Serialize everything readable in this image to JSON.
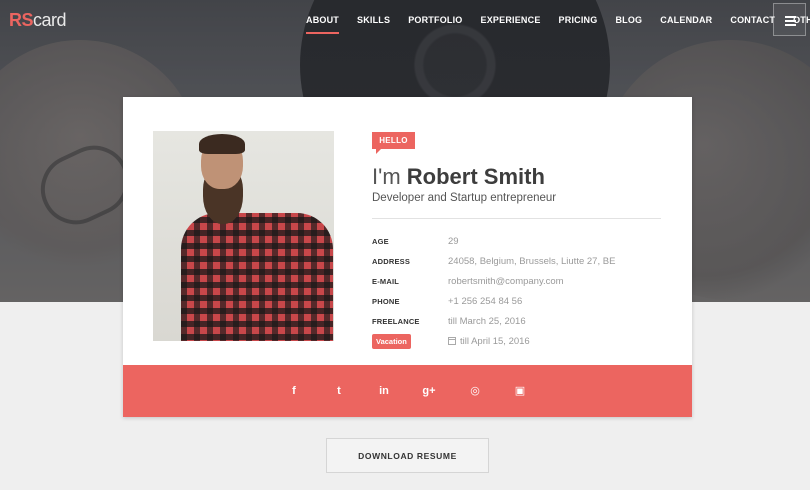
{
  "header": {
    "logo_primary": "RS",
    "logo_secondary": "card",
    "nav": [
      "ABOUT",
      "SKILLS",
      "PORTFOLIO",
      "EXPERIENCE",
      "PRICING",
      "BLOG",
      "CALENDAR",
      "CONTACT",
      "OTHER"
    ],
    "active_nav": "ABOUT"
  },
  "profile": {
    "greeting": "HELLO",
    "name_prefix": "I'm",
    "name": "Robert Smith",
    "title": "Developer and Startup entrepreneur",
    "details": [
      {
        "label": "AGE",
        "value": "29"
      },
      {
        "label": "ADDRESS",
        "value": "24058, Belgium, Brussels, Liutte 27, BE"
      },
      {
        "label": "E-MAIL",
        "value": "robertsmith@company.com"
      },
      {
        "label": "PHONE",
        "value": "+1 256 254 84 56"
      },
      {
        "label": "FREELANCE",
        "value": "till March 25, 2016"
      }
    ],
    "vacation": {
      "label": "Vacation",
      "value": "till April 15, 2016"
    }
  },
  "social": {
    "icons": [
      "facebook-icon",
      "twitter-icon",
      "linkedin-icon",
      "google-plus-icon",
      "dribbble-icon",
      "instagram-icon"
    ],
    "glyphs": [
      "f",
      "t",
      "in",
      "g+",
      "◎",
      "▣"
    ]
  },
  "download_button": "DOWNLOAD RESUME",
  "colors": {
    "accent": "#ec6560",
    "background": "#efefef",
    "card": "#ffffff"
  }
}
